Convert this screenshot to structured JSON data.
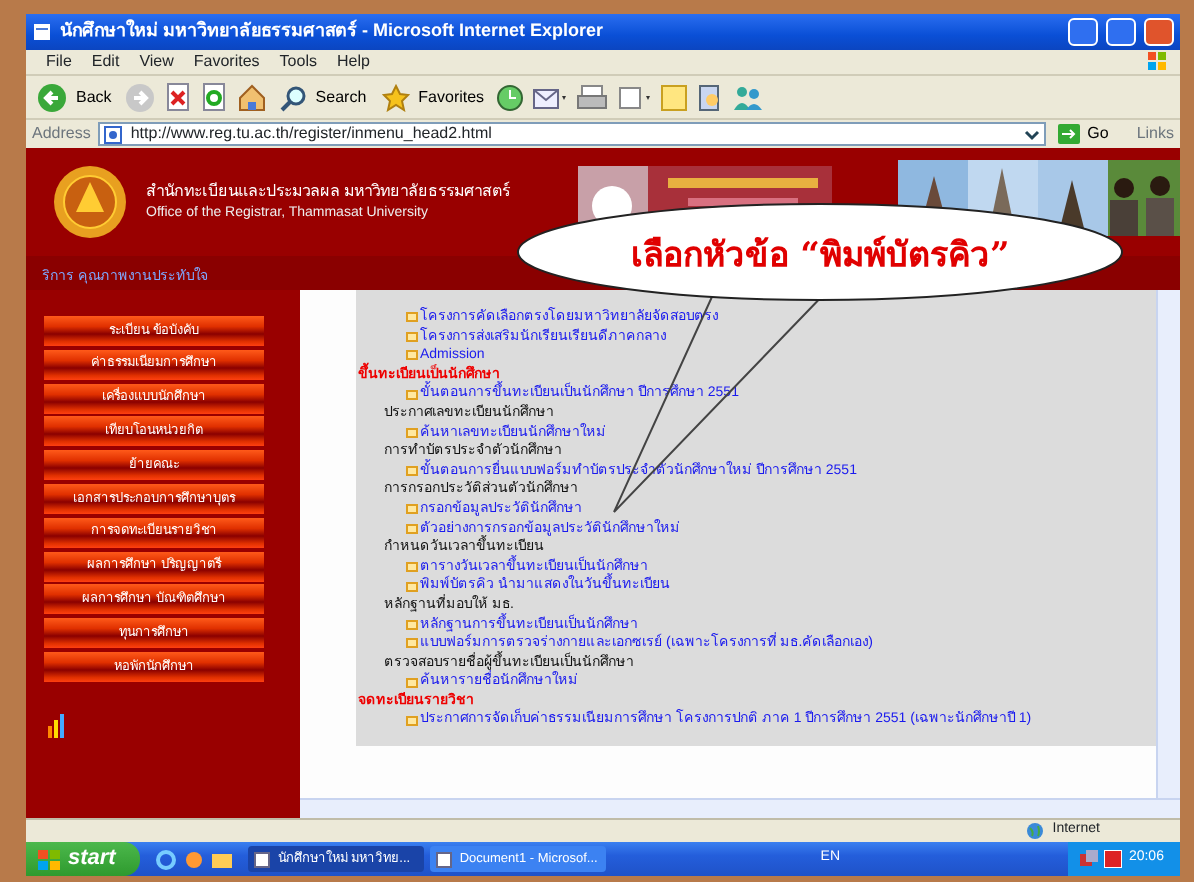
{
  "window": {
    "title": "นักศึกษาใหม่ มหาวิทยาลัยธรรมศาสตร์ - Microsoft Internet Explorer"
  },
  "menu": [
    "File",
    "Edit",
    "View",
    "Favorites",
    "Tools",
    "Help"
  ],
  "toolbar": {
    "back": "Back",
    "search": "Search",
    "favorites": "Favorites"
  },
  "address": {
    "label": "Address",
    "url": "http://www.reg.tu.ac.th/register/inmenu_head2.html",
    "go": "Go",
    "links": "Links"
  },
  "header": {
    "thai": "สำนักทะเบียนและประมวลผล มหาวิทยาลัยธรรมศาสตร์",
    "english": "Office of the Registrar, Thammasat University"
  },
  "tagline": "ริการ คุณภาพงานประทับใจ",
  "sidebar": [
    "ระเบียน ข้อบังคับ",
    "ค่าธรรมเนียมการศึกษา",
    "เครื่องแบบนักศึกษา",
    "เทียบโอนหน่วยกิต",
    "ย้ายคณะ",
    "เอกสารประกอบการศึกษาบุตร",
    "การจดทะเบียนรายวิชา",
    "ผลการศึกษา ปริญญาตรี",
    "ผลการศึกษา บัณฑิตศึกษา",
    "ทุนการศึกษา",
    "หอพักนักศึกษา"
  ],
  "content": [
    {
      "kind": "link",
      "text": "โครงการคัดเลือกตรงโดยมหาวิทยาลัยจัดสอบตรง"
    },
    {
      "kind": "link",
      "text": "โครงการส่งเสริมนักเรียนเรียนดีภาคกลาง"
    },
    {
      "kind": "link",
      "text": "Admission"
    },
    {
      "kind": "heading",
      "text": "ขึ้นทะเบียนเป็นนักศึกษา"
    },
    {
      "kind": "link",
      "text": "ขั้นตอนการขึ้นทะเบียนเป็นนักศึกษา ปีการศึกษา 2551"
    },
    {
      "kind": "sub",
      "text": "ประกาศเลขทะเบียนนักศึกษา"
    },
    {
      "kind": "link",
      "text": "ค้นหาเลขทะเบียนนักศึกษาใหม่"
    },
    {
      "kind": "sub",
      "text": "การทำบัตรประจำตัวนักศึกษา"
    },
    {
      "kind": "link",
      "text": "ขั้นตอนการยื่นแบบฟอร์มทำบัตรประจำตัวนักศึกษาใหม่ ปีการศึกษา 2551"
    },
    {
      "kind": "sub",
      "text": "การกรอกประวัติส่วนตัวนักศึกษา"
    },
    {
      "kind": "link",
      "text": "กรอกข้อมูลประวัตินักศึกษา"
    },
    {
      "kind": "link",
      "text": "ตัวอย่างการกรอกข้อมูลประวัตินักศึกษาใหม่"
    },
    {
      "kind": "sub",
      "text": "กำหนดวันเวลาขึ้นทะเบียน"
    },
    {
      "kind": "link",
      "text": "ตารางวันเวลาขึ้นทะเบียนเป็นนักศึกษา"
    },
    {
      "kind": "link",
      "text": "พิมพ์บัตรคิว นำมาแสดงในวันขึ้นทะเบียน"
    },
    {
      "kind": "sub",
      "text": "หลักฐานที่มอบให้ มธ."
    },
    {
      "kind": "link",
      "text": "หลักฐานการขึ้นทะเบียนเป็นนักศึกษา"
    },
    {
      "kind": "link",
      "text": "แบบฟอร์มการตรวจร่างกายและเอกซเรย์ (เฉพาะโครงการที่ มธ.คัดเลือกเอง)"
    },
    {
      "kind": "sub",
      "text": "ตรวจสอบรายชื่อผู้ขึ้นทะเบียนเป็นนักศึกษา"
    },
    {
      "kind": "link",
      "text": "ค้นหารายชื่อนักศึกษาใหม่"
    },
    {
      "kind": "heading",
      "text": "จดทะเบียนรายวิชา"
    },
    {
      "kind": "link",
      "text": "ประกาศการจัดเก็บค่าธรรมเนียมการศึกษา โครงการปกติ ภาค 1 ปีการศึกษา 2551 (เฉพาะนักศึกษาปี 1)"
    }
  ],
  "callout": {
    "text": "เลือกหัวข้อ “พิมพ์บัตรคิว”"
  },
  "status_bar": {
    "zone": "Internet"
  },
  "taskbar": {
    "start": "start",
    "tasks": [
      {
        "label": "นักศึกษาใหม่ มหาวิทย...",
        "selected": true
      },
      {
        "label": "Document1 - Microsof...",
        "selected": false
      }
    ],
    "language": "EN",
    "clock": "20:06"
  }
}
